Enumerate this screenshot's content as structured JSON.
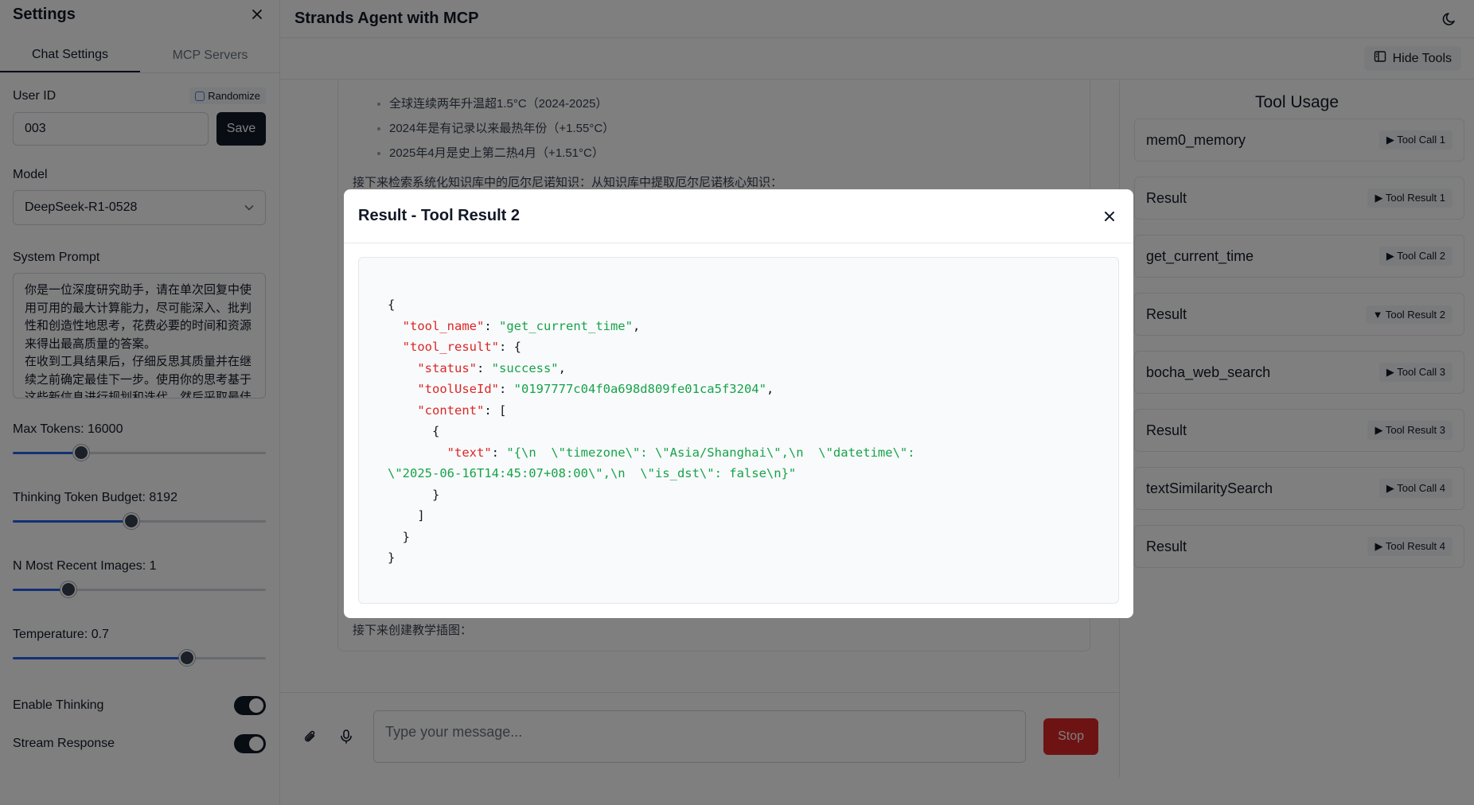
{
  "sidebar": {
    "title": "Settings",
    "tabs": [
      "Chat Settings",
      "MCP Servers"
    ],
    "user_id_label": "User ID",
    "randomize_label": "Randomize",
    "user_id_value": "003",
    "save_label": "Save",
    "model_label": "Model",
    "model_value": "DeepSeek-R1-0528",
    "system_prompt_label": "System Prompt",
    "system_prompt_value": "你是一位深度研究助手，请在单次回复中使用可用的最大计算能力，尽可能深入、批判性和创造性地思考，花费必要的时间和资源来得出最高质量的答案。\n在收到工具结果后，仔细反思其质量并在继续之前确定最佳下一步。使用你的思考基于这些新信息进行规划和迭代，然后采取最佳的下一步行动。",
    "max_tokens_label": "Max Tokens: 16000",
    "max_tokens_fraction": 0.27,
    "thinking_budget_label": "Thinking Token Budget: 8192",
    "thinking_budget_fraction": 0.47,
    "recent_images_label": "N Most Recent Images: 1",
    "recent_images_fraction": 0.22,
    "temperature_label": "Temperature: 0.7",
    "temperature_fraction": 0.69,
    "enable_thinking_label": "Enable Thinking",
    "stream_response_label": "Stream Response"
  },
  "main": {
    "title": "Strands Agent with MCP",
    "hide_tools_label": "Hide Tools",
    "bullets": [
      "全球连续两年升温超1.5°C（2024-2025）",
      "2024年是有记录以来最热年份（+1.55°C）",
      "2025年4月是史上第二热4月（+1.51°C）"
    ],
    "msg_line": "接下来检索系统化知识库中的厄尔尼诺知识：从知识库中提取厄尔尼诺核心知识：",
    "msg_last": "接下来创建教学插图：",
    "input_placeholder": "Type your message...",
    "stop_label": "Stop"
  },
  "tool_panel": {
    "title": "Tool Usage",
    "items": [
      {
        "name": "mem0_memory",
        "badge": "▶ Tool Call 1"
      },
      {
        "name": "Result",
        "badge": "▶ Tool Result 1"
      },
      {
        "name": "get_current_time",
        "badge": "▶ Tool Call 2"
      },
      {
        "name": "Result",
        "badge": "▼ Tool Result 2"
      },
      {
        "name": "bocha_web_search",
        "badge": "▶ Tool Call 3"
      },
      {
        "name": "Result",
        "badge": "▶ Tool Result 3"
      },
      {
        "name": "textSimilaritySearch",
        "badge": "▶ Tool Call 4"
      },
      {
        "name": "Result",
        "badge": "▶ Tool Result 4"
      }
    ]
  },
  "modal": {
    "title": "Result - Tool Result 2",
    "keys": {
      "tool_name": "\"tool_name\"",
      "tool_result": "\"tool_result\"",
      "status": "\"status\"",
      "toolUseId": "\"toolUseId\"",
      "content": "\"content\"",
      "text": "\"text\""
    },
    "values": {
      "tool_name": "\"get_current_time\"",
      "status": "\"success\"",
      "toolUseId": "\"0197777c04f0a698d809fe01ca5f3204\"",
      "text_line1": "\"{\\n  \\\"timezone\\\": \\\"Asia/Shanghai\\\",\\n  \\\"datetime\\\":",
      "text_line2": "\\\"2025-06-16T14:45:07+08:00\\\",\\n  \\\"is_dst\\\": false\\n}\""
    }
  },
  "colors": {
    "accent": "#2563eb",
    "stop": "#dc2626",
    "json_key": "#dc2626",
    "json_string": "#16a34a"
  }
}
